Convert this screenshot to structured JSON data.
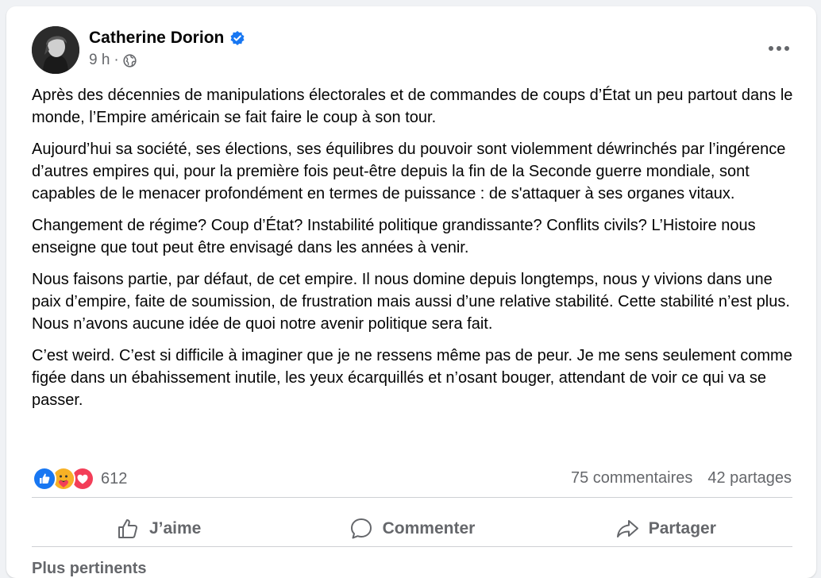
{
  "post": {
    "author": "Catherine Dorion",
    "time": "9 h",
    "separator": "·",
    "paragraphs": [
      "Après des décennies de manipulations électorales et de commandes de coups d’État un peu partout dans le monde, l’Empire américain se fait faire le coup à son tour.",
      "Aujourd’hui sa société, ses élections, ses équilibres du pouvoir sont violemment déwrinchés par l’ingérence d’autres empires qui, pour la première fois peut-être depuis la fin de la Seconde guerre mondiale, sont capables de le menacer profondément en termes de puissance : de s'attaquer à ses organes vitaux.",
      "Changement de régime? Coup d’État? Instabilité politique grandissante? Conflits civils? L’Histoire nous enseigne que tout peut être envisagé dans les années à venir.",
      "Nous faisons partie, par défaut, de cet empire. Il nous domine depuis longtemps, nous y vivions dans une paix d’empire, faite de soumission, de frustration mais aussi d’une relative stabilité. Cette stabilité n’est plus. Nous n’avons aucune idée de quoi notre avenir politique sera fait.",
      "C’est weird. C’est si difficile à imaginer que je ne ressens même pas de peur. Je me sens seulement comme figée dans un ébahissement inutile, les yeux écarquillés et n’osant bouger, attendant de voir ce qui va se passer."
    ]
  },
  "reactions": {
    "count": "612",
    "icons": [
      "like-icon",
      "care-icon",
      "love-icon"
    ]
  },
  "stats": {
    "comments": "75 commentaires",
    "shares": "42 partages"
  },
  "actions": {
    "like": "J’aime",
    "comment": "Commenter",
    "share": "Partager"
  },
  "comments_sort": "Plus pertinents",
  "colors": {
    "verified": "#1877f2",
    "like": "#1877f2",
    "love": "#f33e58",
    "care": "#f7b125",
    "secondary_text": "#65676b"
  }
}
